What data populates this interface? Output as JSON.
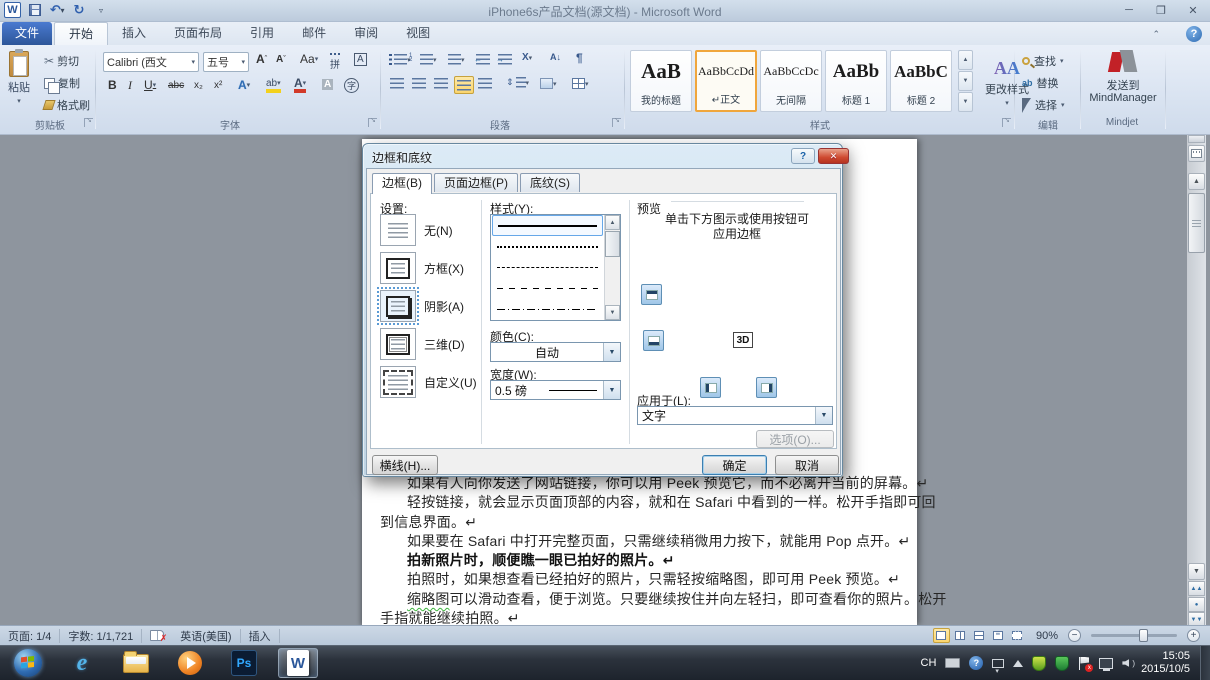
{
  "window": {
    "title": "iPhone6s产品文档(源文档) - Microsoft Word"
  },
  "ribbon": {
    "file_tab": "文件",
    "tabs": [
      {
        "label": "开始",
        "active": true
      },
      {
        "label": "插入"
      },
      {
        "label": "页面布局"
      },
      {
        "label": "引用"
      },
      {
        "label": "邮件"
      },
      {
        "label": "审阅"
      },
      {
        "label": "视图"
      }
    ],
    "groups": {
      "clipboard": {
        "title": "剪贴板",
        "paste": "粘贴",
        "cut": "剪切",
        "copy": "复制",
        "format_painter": "格式刷"
      },
      "font": {
        "title": "字体",
        "name_value": "Calibri (西文",
        "size_value": "五号",
        "bold": "B",
        "italic": "I",
        "underline": "U",
        "strike": "abc",
        "subscript": "x₂",
        "superscript": "x²",
        "change_case": "Aa",
        "grow": "A",
        "shrink": "A",
        "text_effects": "A",
        "highlight": "ab",
        "font_color": "A",
        "char_shading": "A",
        "enclose": "字",
        "phonetic": "拼",
        "char_border": "A"
      },
      "paragraph": {
        "title": "段落"
      },
      "styles": {
        "title": "样式",
        "gallery": [
          {
            "preview": "AaB",
            "label": "我的标题"
          },
          {
            "preview": "AaBbCcDd",
            "label": "↵正文",
            "selected": true
          },
          {
            "preview": "AaBbCcDc",
            "label": "无间隔"
          },
          {
            "preview": "AaBb",
            "label": "标题 1"
          },
          {
            "preview": "AaBbC",
            "label": "标题 2"
          }
        ],
        "change_styles": "更改样式"
      },
      "editing": {
        "title": "编辑",
        "find": "查找",
        "replace": "替换",
        "select": "选择"
      },
      "mindjet": {
        "title": "Mindjet",
        "send_line1": "发送到",
        "send_line2": "MindManager"
      }
    }
  },
  "dialog": {
    "title": "边框和底纹",
    "close_glyph": "✕",
    "help_glyph": "?",
    "tabs": [
      {
        "label": "边框(B)",
        "active": true
      },
      {
        "label": "页面边框(P)"
      },
      {
        "label": "底纹(S)"
      }
    ],
    "settings": {
      "label": "设置:",
      "options": [
        {
          "label": "无(N)"
        },
        {
          "label": "方框(X)"
        },
        {
          "label": "阴影(A)",
          "selected": true
        },
        {
          "label": "三维(D)"
        },
        {
          "label": "自定义(U)"
        }
      ]
    },
    "style": {
      "label": "样式(Y):"
    },
    "line_styles": [
      "solid",
      "dotted",
      "dashed-small",
      "dashed-large",
      "dash-dot"
    ],
    "line_style_selected_index": 0,
    "color": {
      "label": "颜色(C):",
      "value": "自动"
    },
    "width": {
      "label": "宽度(W):",
      "value": "0.5 磅"
    },
    "preview": {
      "label": "预览",
      "hint_line1": "单击下方图示或使用按钮可",
      "hint_line2": "应用边框",
      "center_label": "3D",
      "buttons": [
        {
          "icon": "apply-top-border-button"
        },
        {
          "icon": "apply-bottom-border-button"
        },
        {
          "icon": "apply-left-border-button"
        },
        {
          "icon": "apply-right-border-button"
        }
      ]
    },
    "apply": {
      "label": "应用于(L):",
      "value": "文字"
    },
    "options_button": "选项(O)...",
    "hline_button": "横线(H)...",
    "ok": "确定",
    "cancel": "取消"
  },
  "document": {
    "lines": [
      {
        "text": "如果有人向你发送了网站链接，你可以用 Peek 预览它，而不必离开当前的屏幕。↵",
        "indent": true
      },
      {
        "text": "轻按链接，就会显示页面顶部的内容，就和在 Safari 中看到的一样。松开手指即可回",
        "indent": true
      },
      {
        "text": "到信息界面。↵"
      },
      {
        "text": "如果要在 Safari 中打开完整页面，只需继续稍微用力按下，就能用 Pop 点开。↵",
        "indent": true
      },
      {
        "text": "拍新照片时，顺便瞧一眼已拍好的照片。↵",
        "indent": true,
        "bold": true
      },
      {
        "text": "拍照时，如果想查看已经拍好的照片，只需轻按缩略图，即可用 Peek 预览。↵",
        "indent": true
      },
      {
        "pre": "缩略图",
        "text": "可以滑动查看，便于浏览。只要继续按住并向左轻扫，即可查看你的照片。松开",
        "indent": true
      },
      {
        "text": "手指就能继续拍照。↵"
      }
    ]
  },
  "status_bar": {
    "page": "页面: 1/4",
    "words": "字数: 1/1,721",
    "language": "英语(美国)",
    "mode": "插入",
    "zoom": "90%",
    "view_buttons": [
      "print-layout",
      "full-screen-reading",
      "web-layout",
      "outline",
      "draft"
    ]
  },
  "taskbar": {
    "apps": [
      {
        "icon": "start-orb"
      },
      {
        "icon": "internet-explorer",
        "label": "e"
      },
      {
        "icon": "windows-explorer"
      },
      {
        "icon": "media-player"
      },
      {
        "icon": "photoshop",
        "label": "Ps"
      },
      {
        "icon": "word",
        "active": true
      }
    ],
    "tray": [
      {
        "icon": "ime-language",
        "label": "CH"
      },
      {
        "icon": "keyboard"
      },
      {
        "icon": "help-tray",
        "label": "?"
      },
      {
        "icon": "ime-toolbar"
      },
      {
        "icon": "show-hidden"
      },
      {
        "icon": "antivirus"
      },
      {
        "icon": "security"
      },
      {
        "icon": "flag"
      },
      {
        "icon": "network"
      },
      {
        "icon": "volume"
      }
    ],
    "clock": {
      "time": "15:05",
      "date": "2015/10/5"
    }
  }
}
